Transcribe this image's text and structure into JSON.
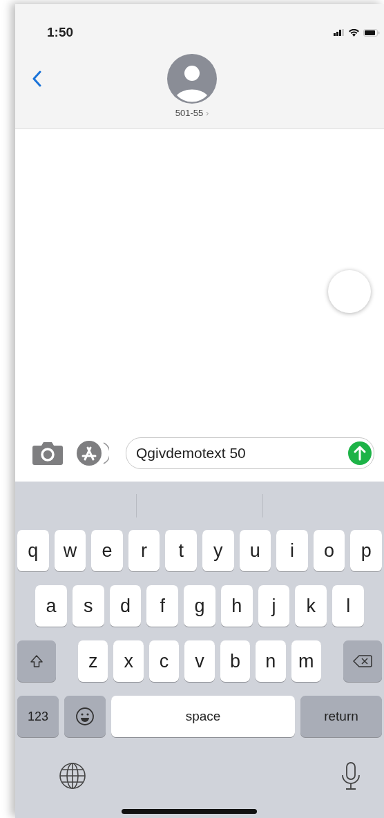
{
  "status_bar": {
    "time": "1:50"
  },
  "header": {
    "contact": "501-55",
    "chevron": "›"
  },
  "composer": {
    "value": "Qgivdemotext 50"
  },
  "keyboard": {
    "rows": [
      [
        "q",
        "w",
        "e",
        "r",
        "t",
        "y",
        "u",
        "i",
        "o",
        "p"
      ],
      [
        "a",
        "s",
        "d",
        "f",
        "g",
        "h",
        "j",
        "k",
        "l"
      ],
      [
        "z",
        "x",
        "c",
        "v",
        "b",
        "n",
        "m"
      ]
    ],
    "number_key": "123",
    "space_key": "space",
    "return_key": "return"
  }
}
